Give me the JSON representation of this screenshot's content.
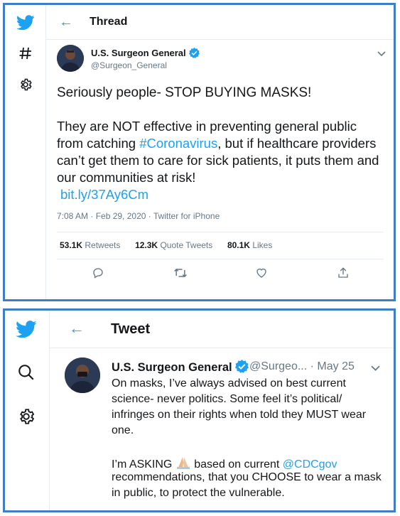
{
  "thread": {
    "title": "Thread",
    "author": {
      "name": "U.S. Surgeon General",
      "handle": "@Surgeon_General"
    },
    "lines": [
      "Seriously people- STOP BUYING MASKS!",
      "They are NOT effective in preventing general public",
      "from catching ",
      "#Coronavirus",
      ", but if healthcare providers",
      "can’t get them to care for sick patients, it puts them and",
      "our communities at risk!"
    ],
    "link": "bit.ly/37Ay6Cm",
    "meta": "7:08 AM · Feb 29, 2020 · Twitter for iPhone",
    "stats": {
      "retweets_value": "53.1K",
      "retweets_label": " Retweets",
      "quotes_value": "12.3K",
      "quotes_label": " Quote Tweets",
      "likes_value": "80.1K",
      "likes_label": " Likes"
    },
    "icons": [
      "twitter-logo",
      "hashtag",
      "gear",
      "back-arrow",
      "chevron-down",
      "reply",
      "retweet",
      "like",
      "share"
    ]
  },
  "tweet": {
    "title": "Tweet",
    "author": {
      "name": "U.S. Surgeon General",
      "handle": "@Surgeo...",
      "dot": "·",
      "date": "May 25"
    },
    "lines": [
      "On masks, I’ve always advised on best current",
      "science- never politics.  Some feel it’s political/",
      "infringes on their rights when told they MUST wear",
      "one."
    ],
    "asking_pre": "I’m ASKING ",
    "asking_post": " based on current ",
    "mention": "@CDCgov",
    "lines2": [
      "recommendations, that you CHOOSE to wear a mask",
      "in public, to protect the vulnerable."
    ],
    "icons": [
      "twitter-logo",
      "search",
      "gear",
      "back-arrow",
      "chevron-down",
      "folded-hands"
    ]
  },
  "colors": {
    "accent": "#1da1f2",
    "frame": "#3f7ec4",
    "muted": "#657786",
    "divider": "#e6ecf0"
  }
}
